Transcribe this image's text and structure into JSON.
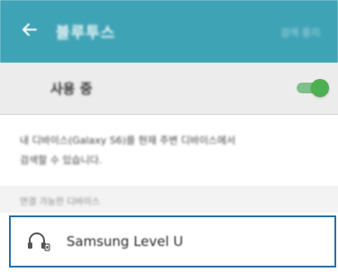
{
  "header": {
    "title": "블루투스",
    "action_label": "검색 중지",
    "back_icon": "back-arrow-icon",
    "background_color": "#3fa3b6"
  },
  "toggle": {
    "label": "사용 중",
    "state": "on",
    "accent_color": "#4caf50"
  },
  "description": {
    "line1": "내 디바이스(Galaxy S6)를 현재 주변 디바이스에서",
    "line2": "검색할 수 있습니다."
  },
  "section": {
    "label": "연결 가능한 디바이스"
  },
  "devices": [
    {
      "name": "Samsung Level U",
      "icon": "headset-icon",
      "selected": true,
      "highlight_color": "#2a6fa6"
    }
  ]
}
